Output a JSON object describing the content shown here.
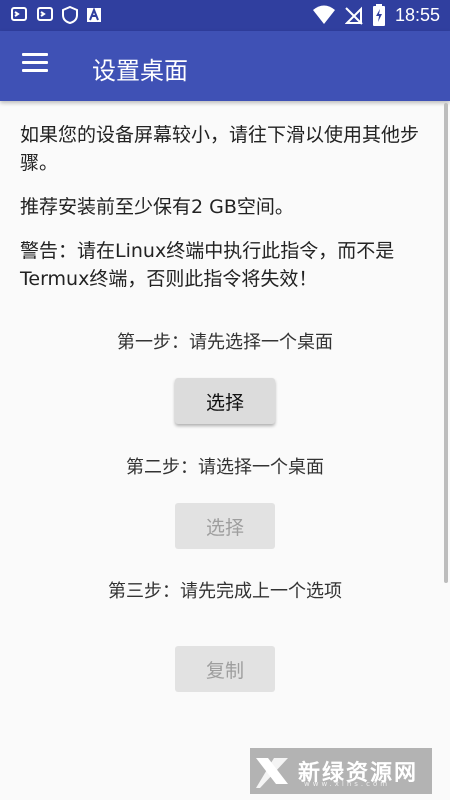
{
  "status_bar": {
    "time": "18:55",
    "left_icons": [
      "termux-icon",
      "termux-icon",
      "vpn-shield-icon",
      "font-a-icon"
    ],
    "right_icons": [
      "wifi-icon",
      "no-signal-icon",
      "battery-charging-icon"
    ]
  },
  "app_bar": {
    "title": "设置桌面",
    "menu_icon": "menu-icon",
    "color": "#3f51b5"
  },
  "content": {
    "intro": "如果您的设备屏幕较小，请往下滑以使用其他步骤。",
    "storage_note": "推荐安装前至少保有2 GB空间。",
    "warning": "警告：请在Linux终端中执行此指令，而不是Termux终端，否则此指令将失效！"
  },
  "steps": [
    {
      "label": "第一步：请先选择一个桌面",
      "button": "选择",
      "enabled": true
    },
    {
      "label": "第二步：请选择一个桌面",
      "button": "选择",
      "enabled": false
    },
    {
      "label": "第三步：请先完成上一个选项",
      "button": "复制",
      "enabled": false
    }
  ],
  "watermark": {
    "text": "新绿资源网",
    "url": "www.xlhs.com"
  }
}
